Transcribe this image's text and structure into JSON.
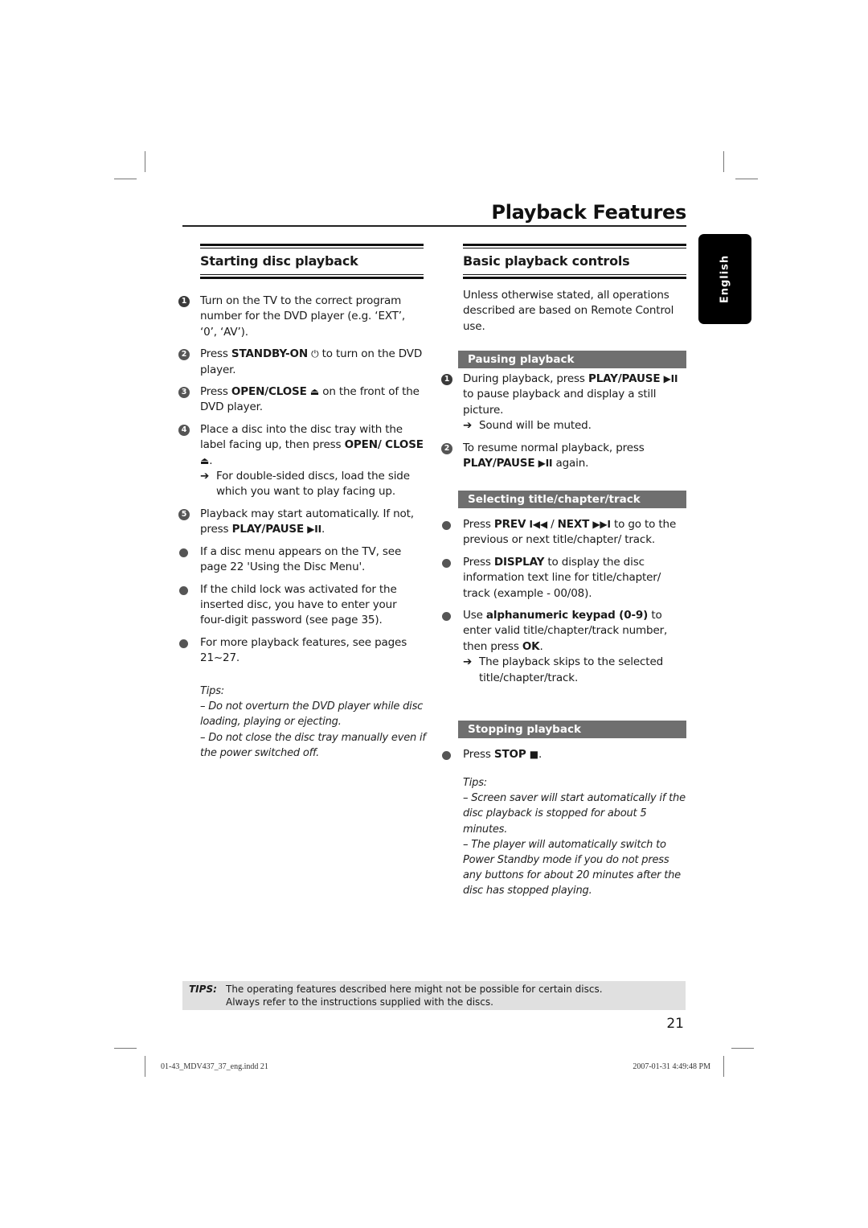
{
  "page": {
    "title": "Playback Features",
    "language_tab": "English",
    "page_number": "21"
  },
  "left": {
    "heading": "Starting disc playback",
    "steps": [
      {
        "n": "1",
        "text": "Turn on the TV to the correct program number for the DVD player (e.g. ‘EXT’, ‘0’, ‘AV’)."
      },
      {
        "n": "2",
        "pre": "Press ",
        "bold": "STANDBY-ON",
        "icon": "⏻",
        "post": " to turn on the DVD player."
      },
      {
        "n": "3",
        "pre": "Press ",
        "bold": "OPEN/CLOSE",
        "icon": "⏏",
        "post": " on the front of the DVD player."
      },
      {
        "n": "4",
        "pre": "Place a disc into the disc tray with the label facing up, then press ",
        "bold": "OPEN/ CLOSE",
        "icon": "⏏",
        "post": ".",
        "note": "For double-sided discs, load the side which you want to play facing up."
      },
      {
        "n": "5",
        "pre": "Playback may start automatically. If not, press ",
        "bold": "PLAY/PAUSE",
        "icon": "▶II",
        "post": "."
      }
    ],
    "bullets": [
      "If a disc menu appears on the TV, see page 22 'Using the Disc Menu'.",
      "If the child lock was activated for the inserted disc, you have to enter your four-digit password (see page 35).",
      "For more playback features, see pages 21~27."
    ],
    "tips_label": "Tips:",
    "tips": [
      "–  Do not overturn the DVD player while disc loading, playing or ejecting.",
      "–  Do not close the disc tray manually even if the power switched off."
    ]
  },
  "right": {
    "heading": "Basic playback controls",
    "intro": "Unless otherwise stated, all operations described are based on Remote Control use.",
    "pausing": {
      "title": "Pausing playback",
      "step1_pre": "During playback, press ",
      "step1_bold": "PLAY/PAUSE",
      "step1_icon": "▶II",
      "step1_post": " to pause playback and display a still picture.",
      "step1_note": "Sound will be muted.",
      "step2_pre": "To resume normal playback, press ",
      "step2_bold": "PLAY/PAUSE",
      "step2_icon": "▶II",
      "step2_post": " again."
    },
    "selecting": {
      "title": "Selecting title/chapter/track",
      "b1_pre": "Press ",
      "b1_bold1": "PREV",
      "b1_icon1": "I◀◀",
      "b1_mid": " / ",
      "b1_bold2": "NEXT",
      "b1_icon2": "▶▶I",
      "b1_post": " to go to the previous or next title/chapter/ track.",
      "b2_pre": "Press ",
      "b2_bold": "DISPLAY",
      "b2_post": " to display the disc information text line for title/chapter/ track (example - 00/08).",
      "b3_pre": "Use ",
      "b3_bold": "alphanumeric keypad (0-9)",
      "b3_mid": " to enter valid title/chapter/track number, then press ",
      "b3_bold2": "OK",
      "b3_post": ".",
      "b3_note": "The playback skips to the selected title/chapter/track."
    },
    "stopping": {
      "title": "Stopping playback",
      "b1_pre": "Press ",
      "b1_bold": "STOP",
      "b1_icon": "■",
      "b1_post": "."
    },
    "tips_label": "Tips:",
    "tips": [
      "–  Screen saver will start automatically if the disc playback is stopped for about 5 minutes.",
      "–  The player will automatically switch to Power Standby mode if you do not press any buttons for about 20 minutes after the disc has stopped playing."
    ]
  },
  "tips_bar": {
    "label": "TIPS:",
    "line1": "The operating features described here might not be possible for certain discs.",
    "line2": "Always refer to the instructions supplied with the discs."
  },
  "footer": {
    "file": "01-43_MDV437_37_eng.indd   21",
    "timestamp": "2007-01-31   4:49:48 PM"
  },
  "arrow_glyph": "➔"
}
